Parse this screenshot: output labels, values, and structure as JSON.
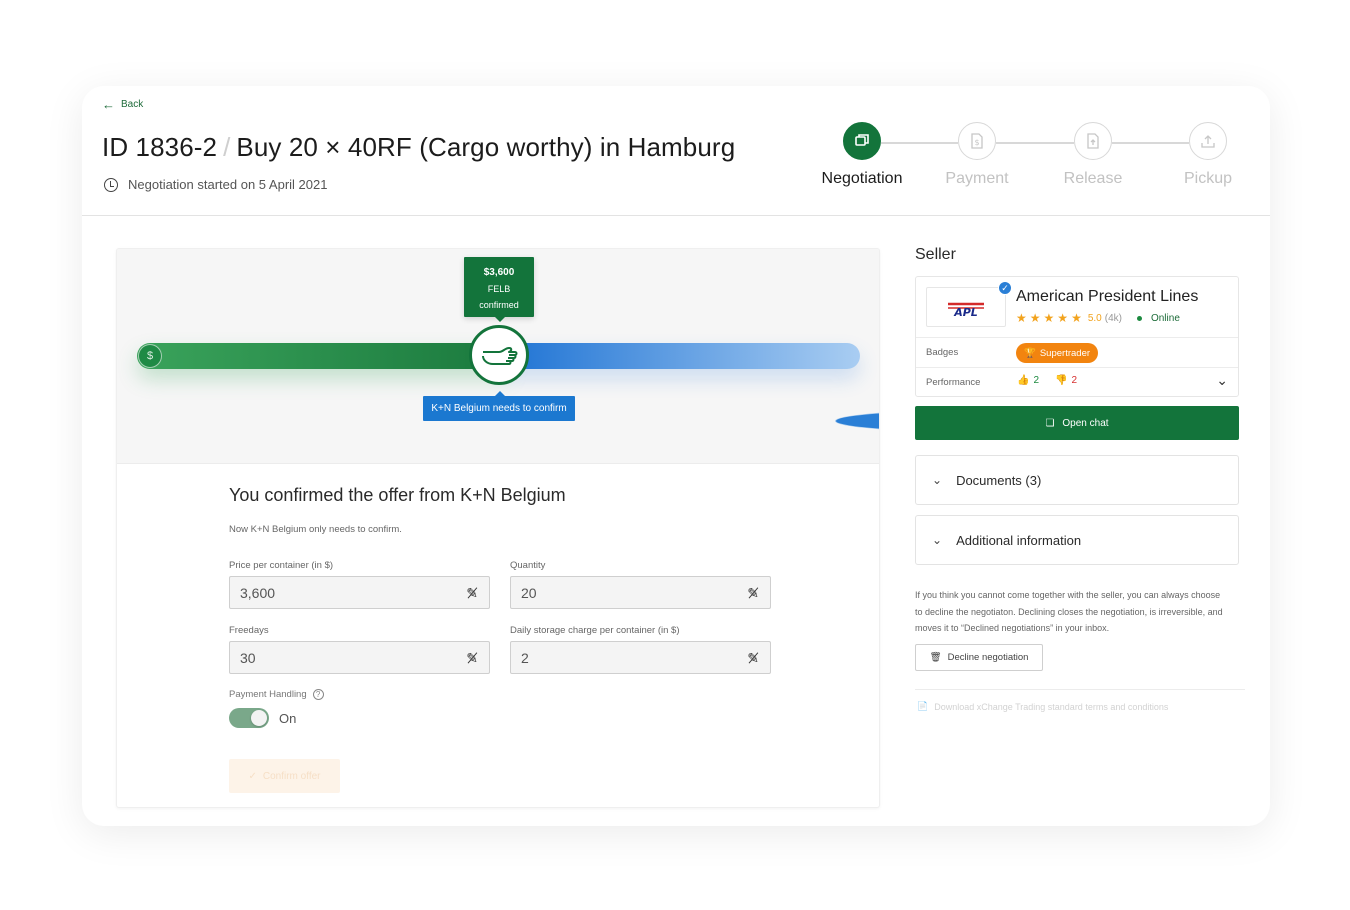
{
  "header": {
    "back_label": "Back",
    "id": "ID 1836-2",
    "separator": "/",
    "title": "Buy 20 × 40RF (Cargo worthy) in Hamburg",
    "started": "Negotiation started on 5 April 2021"
  },
  "stepper": {
    "steps": [
      {
        "label": "Negotiation",
        "icon": "chat-icon",
        "active": true
      },
      {
        "label": "Payment",
        "icon": "document-dollar-icon",
        "active": false
      },
      {
        "label": "Release",
        "icon": "document-up-icon",
        "active": false
      },
      {
        "label": "Pickup",
        "icon": "truck-upload-icon",
        "active": false
      }
    ]
  },
  "slider": {
    "confirmed_price": "$3,600",
    "confirmed_code": "FELB",
    "confirmed_status": "confirmed",
    "pending_label": "K+N Belgium needs to confirm",
    "left_icon": "dollar-icon",
    "right_icon": "dollar-icon",
    "center_icon": "handshake-icon"
  },
  "offer": {
    "heading": "You confirmed the offer from K+N Belgium",
    "note": "Now K+N Belgium only needs to confirm.",
    "fields": {
      "price": {
        "label": "Price per container (in $)",
        "value": "3,600"
      },
      "quantity": {
        "label": "Quantity",
        "value": "20"
      },
      "freedays": {
        "label": "Freedays",
        "value": "30"
      },
      "storage": {
        "label": "Daily storage charge per container (in $)",
        "value": "2"
      }
    },
    "payment_handling_label": "Payment Handling",
    "payment_handling_state": "On",
    "confirm_button": "Confirm offer"
  },
  "seller": {
    "section_title": "Seller",
    "logo_text": "APL",
    "name": "American President Lines",
    "rating": "5.0",
    "rating_count": "(4k)",
    "status": "Online",
    "badges_label": "Badges",
    "badge": "Supertrader",
    "performance_label": "Performance",
    "thumbs_up": "2",
    "thumbs_down": "2",
    "open_chat": "Open chat"
  },
  "sections": {
    "documents": "Documents (3)",
    "additional": "Additional information"
  },
  "decline": {
    "text": "If you think you cannot come together with the seller, you can always choose to decline the negotiaton. Declining closes the negotiation, is irreversible, and moves it to “Declined negotiations” in your inbox.",
    "button": "Decline negotiation"
  },
  "download_link": "Download xChange Trading standard terms and conditions",
  "colors": {
    "brand_green": "#13743b",
    "blue": "#1b78d0",
    "badge_orange": "#f2840f",
    "star": "#f2a31e"
  }
}
